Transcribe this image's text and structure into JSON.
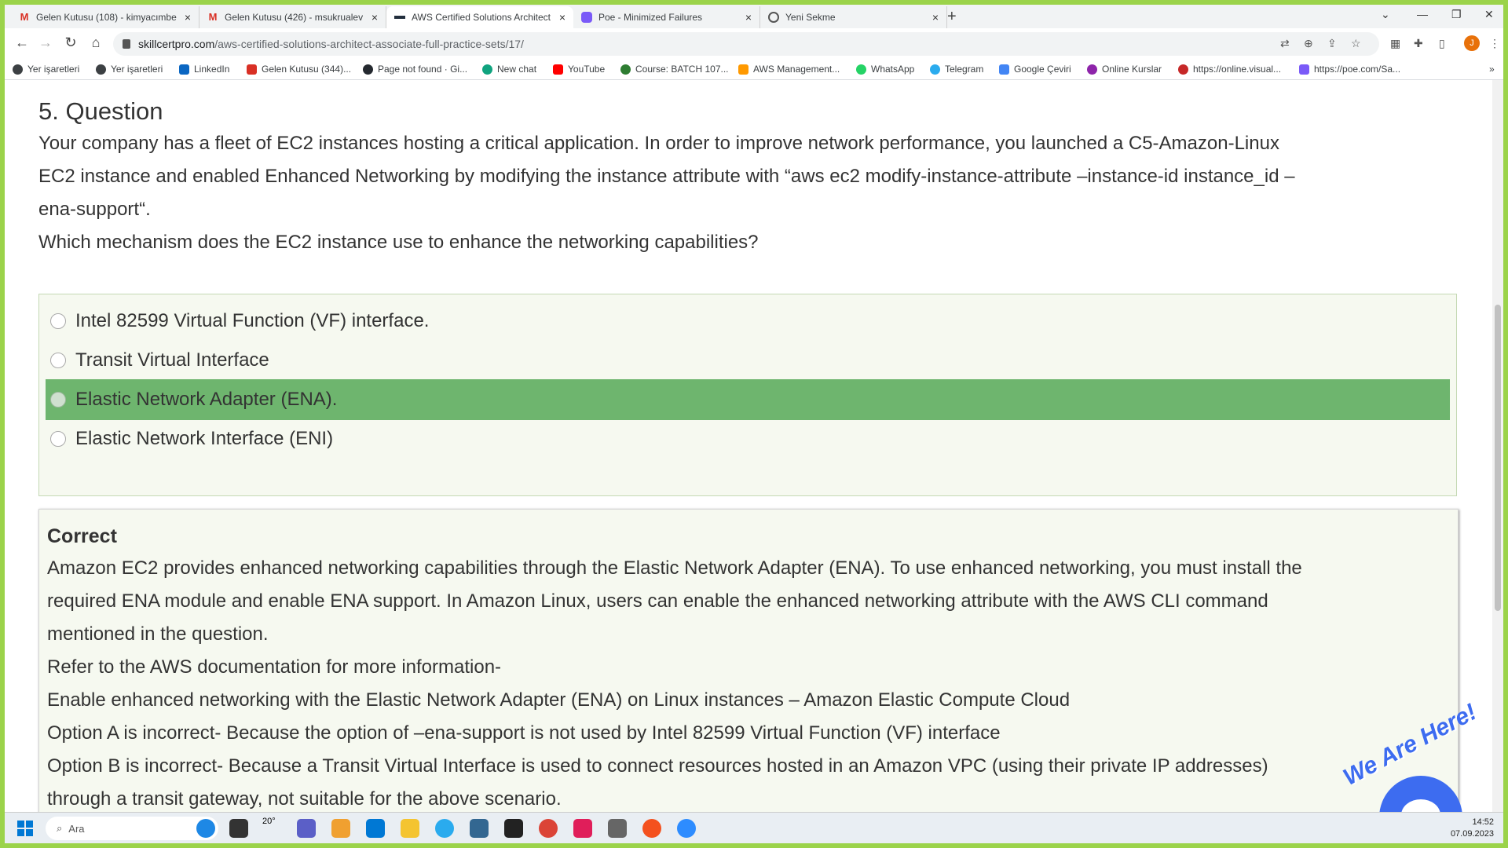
{
  "browser": {
    "tabs": [
      {
        "title": "Gelen Kutusu (108) - kimyacımbe",
        "icon": "gmail-icon"
      },
      {
        "title": "Gelen Kutusu (426) - msukrualev",
        "icon": "gmail-icon"
      },
      {
        "title": "AWS Certified Solutions Architect",
        "icon": "aws-icon"
      },
      {
        "title": "Poe - Minimized Failures",
        "icon": "poe-icon"
      },
      {
        "title": "Yeni Sekme",
        "icon": "globe-icon"
      }
    ],
    "url_host": "skillcertpro.com",
    "url_path": "/aws-certified-solutions-architect-associate-full-practice-sets/17/",
    "profile_initial": "J",
    "bookmarks": [
      {
        "label": "Yer işaretleri",
        "color": "#3c4043"
      },
      {
        "label": "Yer işaretleri",
        "color": "#3c4043"
      },
      {
        "label": "LinkedIn",
        "color": "#0a66c2"
      },
      {
        "label": "Gelen Kutusu (344)...",
        "color": "#d93025"
      },
      {
        "label": "Page not found · Gi...",
        "color": "#24292f"
      },
      {
        "label": "New chat",
        "color": "#10a37f"
      },
      {
        "label": "YouTube",
        "color": "#ff0000"
      },
      {
        "label": "Course: BATCH 107...",
        "color": "#2e7d32"
      },
      {
        "label": "AWS Management...",
        "color": "#ff9900"
      },
      {
        "label": "WhatsApp",
        "color": "#25d366"
      },
      {
        "label": "Telegram",
        "color": "#2aabee"
      },
      {
        "label": "Google Çeviri",
        "color": "#4285f4"
      },
      {
        "label": "Online Kurslar",
        "color": "#8e24aa"
      },
      {
        "label": "https://online.visual...",
        "color": "#c62828"
      },
      {
        "label": "https://poe.com/Sa...",
        "color": "#7a5af8"
      }
    ]
  },
  "question": {
    "title": "5. Question",
    "lines": [
      "Your company has a fleet of EC2 instances hosting a critical application. In order to improve network performance, you launched a C5-Amazon-Linux",
      "EC2 instance and enabled Enhanced Networking by modifying the instance attribute with “aws ec2 modify-instance-attribute –instance-id instance_id –",
      "ena-support“.",
      "Which mechanism does the EC2 instance use to enhance the networking capabilities?"
    ],
    "options": [
      "Intel 82599 Virtual Function (VF) interface.",
      "Transit Virtual Interface",
      "Elastic Network Adapter (ENA).",
      "Elastic Network Interface (ENI)"
    ]
  },
  "explanation": {
    "title": "Correct",
    "lines": [
      "Amazon EC2 provides enhanced networking capabilities through the Elastic Network Adapter (ENA). To use enhanced networking, you must install the",
      "required ENA module and enable ENA support. In Amazon Linux, users can enable the enhanced networking attribute with the AWS CLI command",
      "mentioned in the question.",
      "Refer to the AWS documentation for more information-",
      "Enable enhanced networking with the Elastic Network Adapter (ENA) on Linux instances – Amazon Elastic Compute Cloud",
      "Option A is incorrect- Because the option of –ena-support is not used by Intel 82599 Virtual Function (VF) interface",
      "Option B is incorrect- Because a Transit Virtual Interface is used to connect resources hosted in an Amazon VPC (using their private IP addresses)",
      "through a transit gateway, not suitable for the above scenario."
    ]
  },
  "chat_widget": {
    "label": "We Are Here!"
  },
  "taskbar": {
    "search_placeholder": "Ara",
    "weather": "20°",
    "time": "14:52",
    "date": "07.09.2023"
  },
  "colors": {
    "correct_answer_bg": "#6eb56e",
    "options_bg": "#f6f9f0",
    "chat_accent": "#3d6cf0",
    "frame_green": "#9bd34a"
  }
}
